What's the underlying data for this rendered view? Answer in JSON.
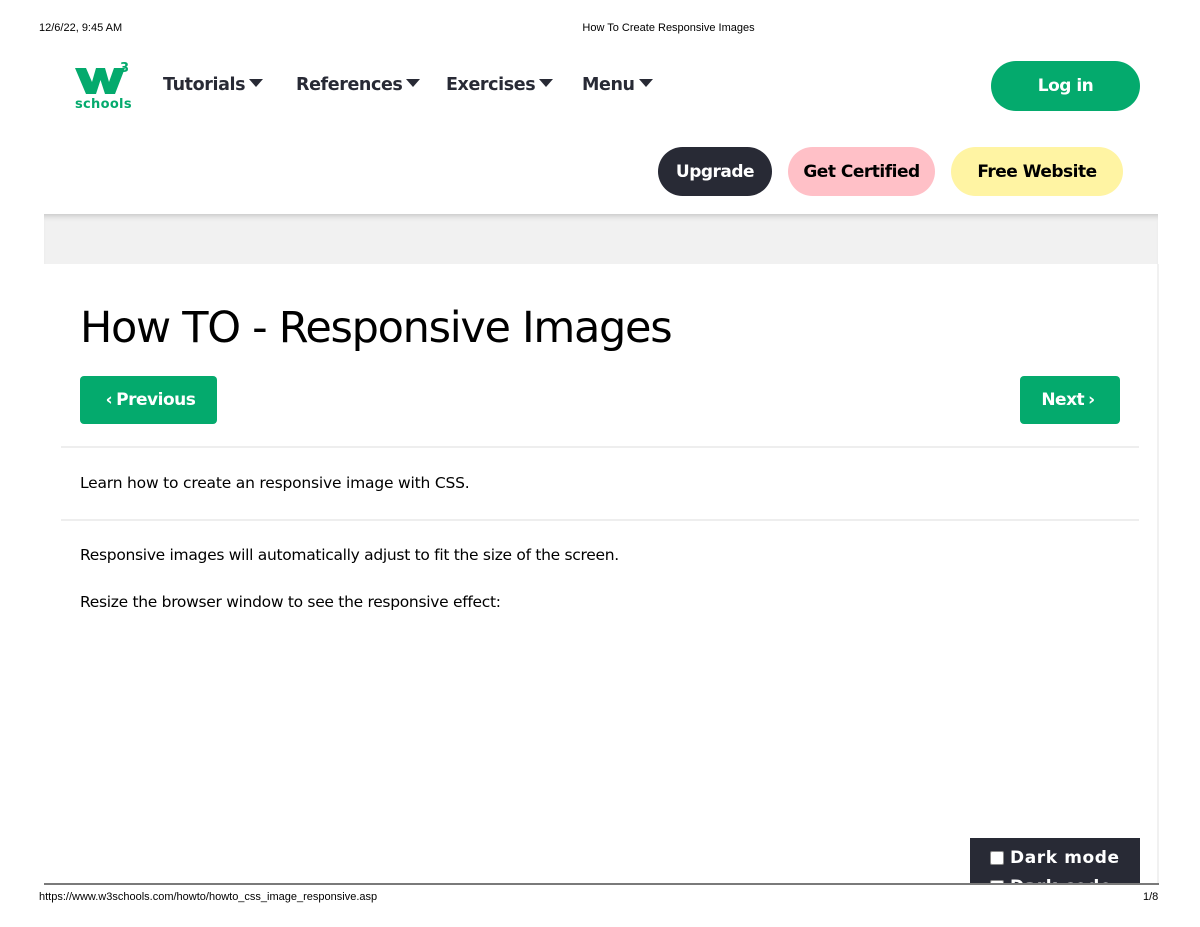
{
  "print_header": {
    "datetime": "12/6/22, 9:45 AM",
    "document_title": "How To Create Responsive Images"
  },
  "brand": {
    "logo_mark": "W3",
    "logo_text": "schools",
    "accent_color": "#04aa6d"
  },
  "nav": {
    "items": [
      {
        "label": "Tutorials",
        "icon": "caret-down-icon"
      },
      {
        "label": "References",
        "icon": "caret-down-icon"
      },
      {
        "label": "Exercises",
        "icon": "caret-down-icon"
      },
      {
        "label": "Menu",
        "icon": "caret-down-icon"
      }
    ],
    "login_label": "Log in"
  },
  "promo_buttons": {
    "upgrade": "Upgrade",
    "get_certified": "Get Certified",
    "free_website": "Free Website"
  },
  "main": {
    "title": "How TO - Responsive Images",
    "previous_label": "Previous",
    "next_label": "Next",
    "intro": "Learn how to create an responsive image with CSS.",
    "paragraphs": [
      "Responsive images will automatically adjust to fit the size of the screen.",
      "Resize the browser window to see the responsive effect:"
    ]
  },
  "dark_mode": {
    "option1_label": "Dark mode",
    "option2_label": "Dark code",
    "option1_checked": false,
    "option2_checked": false
  },
  "print_footer": {
    "url": "https://www.w3schools.com/howto/howto_css_image_responsive.asp",
    "page": "1/8"
  },
  "colors": {
    "green": "#04aa6d",
    "dark": "#282a35",
    "pink": "#ffc0c7",
    "yellow": "#fff4a3",
    "band_gray": "#f1f1f1"
  }
}
